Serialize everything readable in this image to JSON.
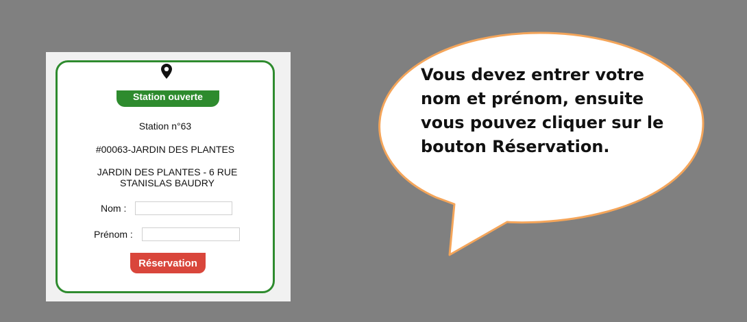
{
  "station": {
    "status_label": "Station ouverte",
    "number": "Station n°63",
    "id_name": "#00063-JARDIN DES PLANTES",
    "address": "JARDIN DES PLANTES - 6 RUE STANISLAS BAUDRY"
  },
  "form": {
    "nom_label": "Nom :",
    "nom_value": "",
    "prenom_label": "Prénom :",
    "prenom_value": "",
    "reserve_label": "Réservation"
  },
  "tooltip": {
    "text": "Vous devez entrer votre nom et prénom, ensuite vous pouvez cliquer sur le bouton Réservation."
  },
  "icons": {
    "location": "map-pin-icon"
  },
  "colors": {
    "background": "#808080",
    "card_border": "#2e8b2e",
    "status_badge": "#2e8b2e",
    "reserve_button": "#d9463b",
    "bubble_border": "#f4a55a"
  }
}
